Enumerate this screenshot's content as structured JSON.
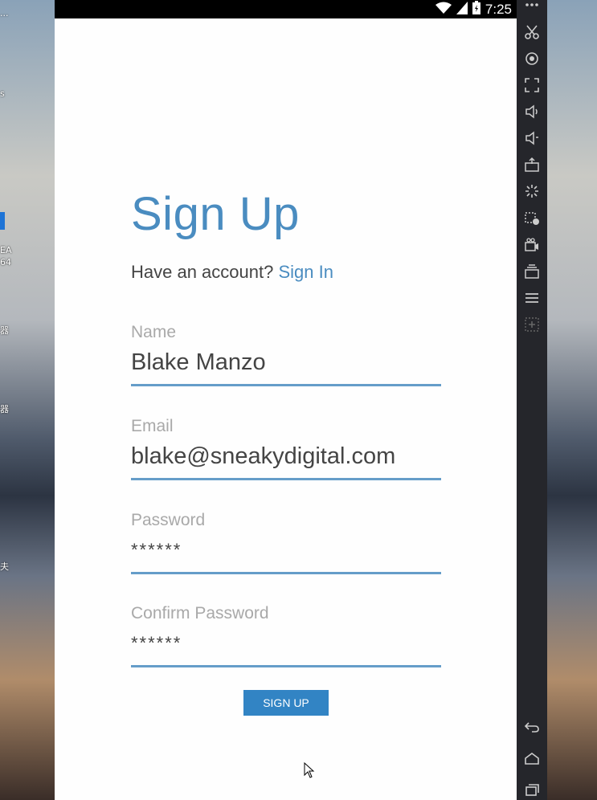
{
  "desktop": {
    "left_labels": [
      "...",
      "s",
      "EA",
      "64",
      "器",
      "器",
      "夫"
    ]
  },
  "status_bar": {
    "time": "7:25",
    "icons": [
      "wifi-icon",
      "signal-icon",
      "battery-icon"
    ]
  },
  "signup": {
    "title": "Sign Up",
    "have_account_text": "Have an account?",
    "sign_in_link": "Sign In",
    "fields": [
      {
        "label": "Name",
        "value": "Blake Manzo"
      },
      {
        "label": "Email",
        "value": "blake@sneakydigital.com"
      },
      {
        "label": "Password",
        "value": "******"
      },
      {
        "label": "Confirm Password",
        "value": "******"
      }
    ],
    "button_label": "SIGN UP"
  },
  "emulator_toolbar": {
    "buttons": [
      "more-icon",
      "scissors-icon",
      "location-icon",
      "fullscreen-icon",
      "volume-up-icon",
      "volume-down-icon",
      "apk-install-icon",
      "loading-icon",
      "screen-record-icon",
      "camera-icon",
      "multi-window-icon",
      "menu-icon",
      "add-icon",
      "back-icon",
      "home-icon",
      "recents-icon"
    ]
  },
  "colors": {
    "accent": "#4a8cc0",
    "button": "#3284c4",
    "label": "#a9a9a9"
  }
}
